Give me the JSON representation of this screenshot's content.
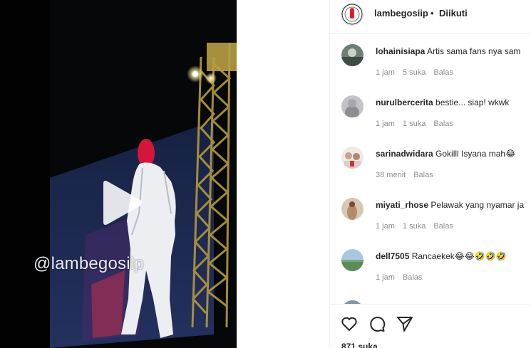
{
  "video": {
    "watermark": "@lambegosiip",
    "play_icon": "play-icon"
  },
  "header": {
    "username": "lambegosiip",
    "separator": "•",
    "follow_status": "Diikuti",
    "avatar_icon": "profile-avatar"
  },
  "comments": [
    {
      "username": "lohainisiapa",
      "text": "Artis sama fans nya sam",
      "time": "1 jam",
      "likes": "5 suka",
      "reply": "Balas",
      "avatar_color": "#6b7f74"
    },
    {
      "username": "nurulbercerita",
      "text": "bestie... siap! wkwk",
      "time": "1 jam",
      "likes": "1 suka",
      "reply": "Balas",
      "avatar_color": "#a7a6aa"
    },
    {
      "username": "sarinadwidara",
      "text": "Gokilll Isyana mah😂",
      "time": "38 menit",
      "likes": "",
      "reply": "Balas",
      "avatar_color": "#d8cfc9"
    },
    {
      "username": "miyati_rhose",
      "text": "Pelawak yang nyamar ja",
      "time": "1 jam",
      "likes": "1 suka",
      "reply": "Balas",
      "avatar_color": "#b58a6a"
    },
    {
      "username": "dell7505",
      "text": "Rancaekek😂😂🤣🤣🤣",
      "time": "1 jam",
      "likes": "",
      "reply": "Balas",
      "avatar_color": "#5d8a5a"
    }
  ],
  "actions": {
    "like_icon": "heart-icon",
    "comment_icon": "comment-icon",
    "share_icon": "send-icon"
  },
  "likes_count": "871 suka"
}
